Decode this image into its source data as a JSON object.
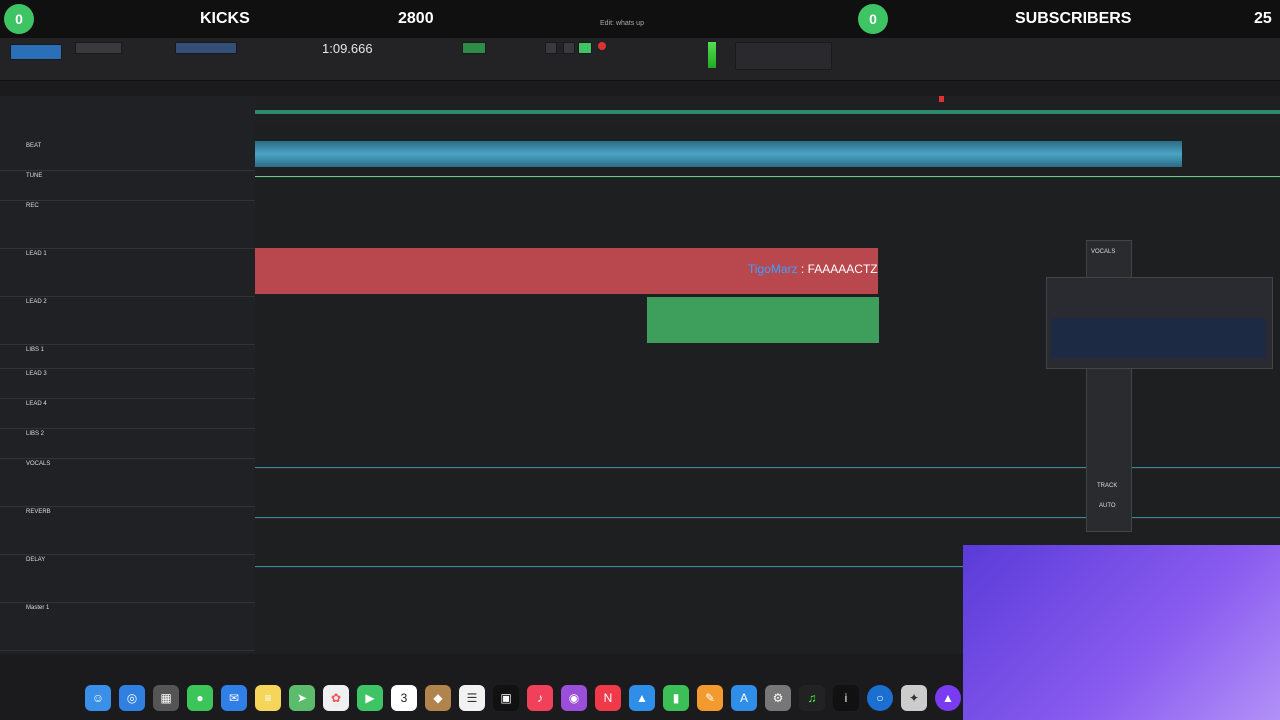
{
  "overlay": {
    "left_count": "0",
    "left_label": "KICKS",
    "left_value": "2800",
    "right_count": "0",
    "right_label": "SUBSCRIBERS",
    "right_value": "25",
    "accent": "#3ec464"
  },
  "window": {
    "title": "Edit: whats up"
  },
  "transport": {
    "counter": "1:09.666"
  },
  "tracks": [
    {
      "name": "BEAT"
    },
    {
      "name": "TUNE"
    },
    {
      "name": "REC"
    },
    {
      "name": "LEAD 1"
    },
    {
      "name": "LEAD 2"
    },
    {
      "name": "LIBS 1"
    },
    {
      "name": "LEAD 3"
    },
    {
      "name": "LEAD 4"
    },
    {
      "name": "LIBS 2"
    },
    {
      "name": "VOCALS"
    },
    {
      "name": "REVERB"
    },
    {
      "name": "DELAY"
    },
    {
      "name": "Master 1"
    }
  ],
  "chat": {
    "user": "TigoMarz",
    "message": ": FAAAAACTZ"
  },
  "mixer": {
    "strip_name": "VOCALS",
    "track_label": "TRACK",
    "auto_label": "AUTO"
  },
  "dock": {
    "calendar_day": "3",
    "apps": [
      "finder-icon",
      "safari-icon",
      "launchpad-icon",
      "messages-icon",
      "mail-icon",
      "notes-icon",
      "maps-icon",
      "photos-icon",
      "facetime-icon",
      "calendar-icon",
      "finder2-icon",
      "reminders-icon",
      "tv-icon",
      "music-icon",
      "podcasts-icon",
      "news-icon",
      "keynote-icon",
      "numbers-icon",
      "pages-icon",
      "appstore-icon",
      "settings-icon",
      "guitar-icon",
      "ilok-icon",
      "circle-icon",
      "compass-icon",
      "protools-icon"
    ]
  }
}
